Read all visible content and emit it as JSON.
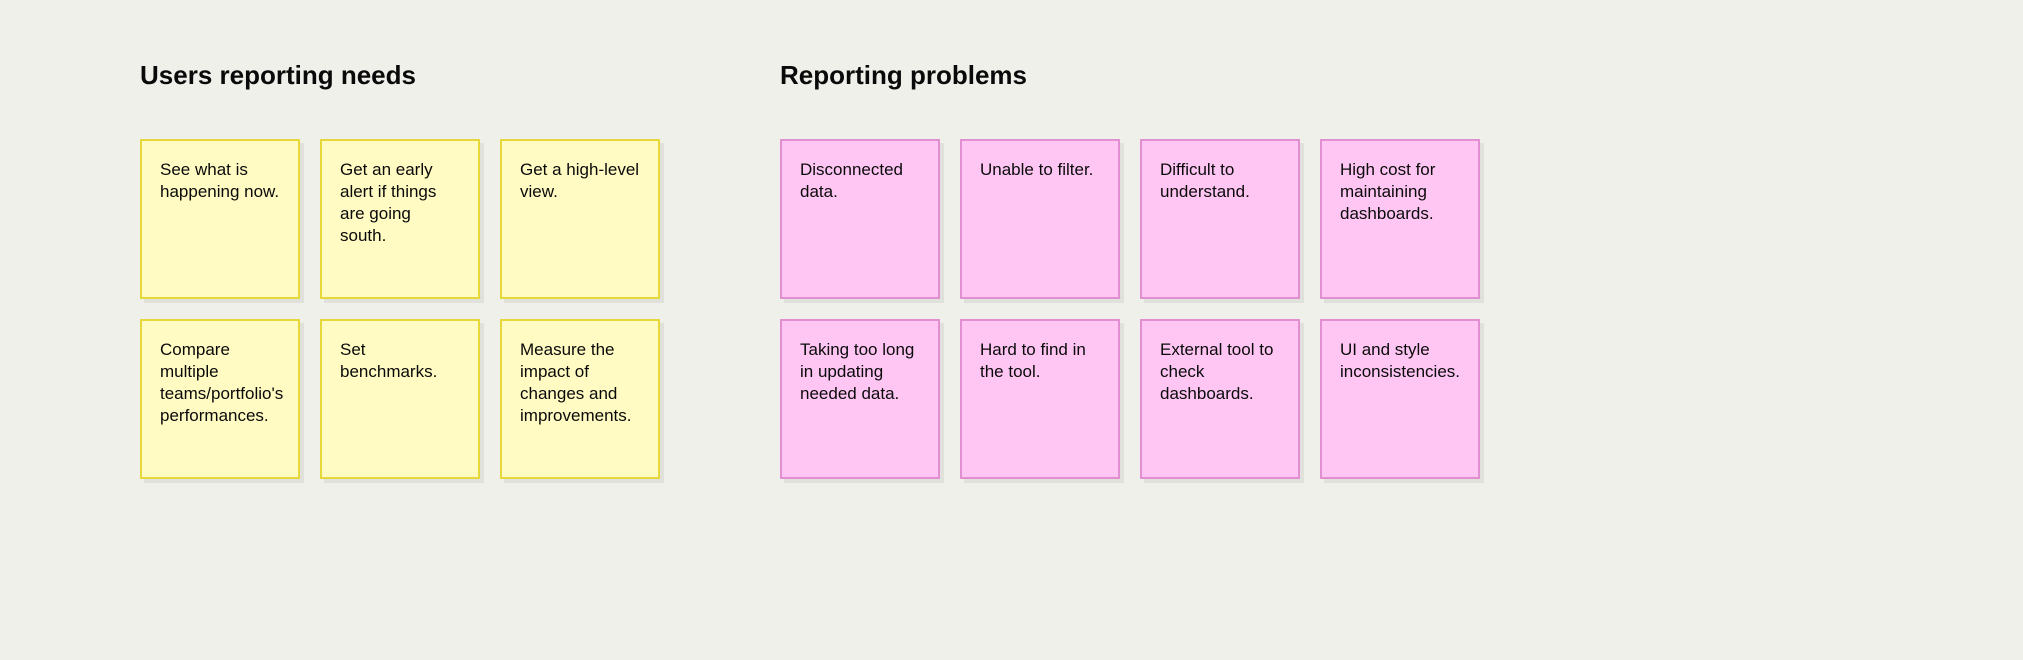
{
  "columns": [
    {
      "title": "Users reporting needs",
      "style": "yellow",
      "gridCols": 3,
      "cards": [
        "See what is happening now.",
        "Get an early alert if things are going south.",
        "Get a high-level view.",
        "Compare multiple teams/portfolio's performances.",
        "Set benchmarks.",
        "Measure the impact of changes and improvements."
      ]
    },
    {
      "title": "Reporting problems",
      "style": "pink",
      "gridCols": 4,
      "cards": [
        "Disconnected data.",
        "Unable to filter.",
        "Difficult to understand.",
        "High cost for maintaining dashboards.",
        "Taking too long in updating needed data.",
        "Hard to find in the tool.",
        "External tool to check dashboards.",
        "UI and style inconsistencies."
      ]
    }
  ]
}
